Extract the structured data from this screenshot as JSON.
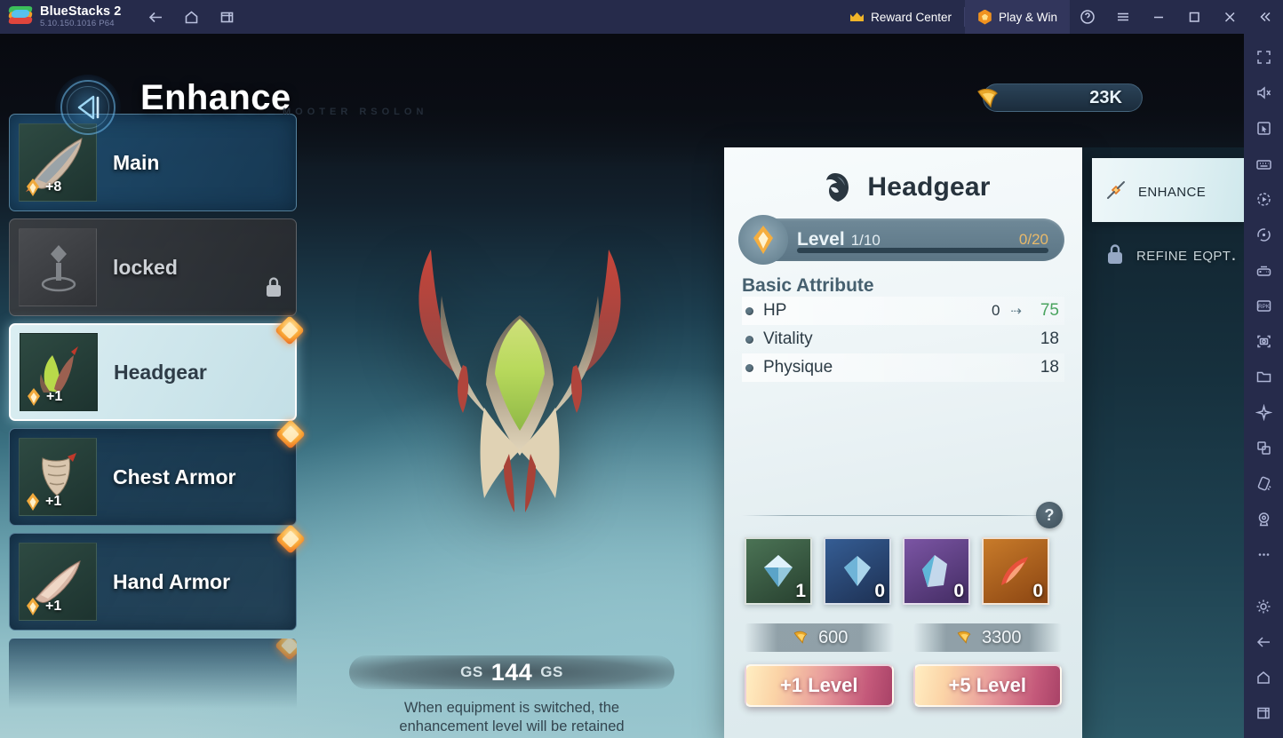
{
  "titlebar": {
    "app_name": "BlueStacks 2",
    "version": "5.10.150.1016  P64",
    "nav": [
      {
        "name": "back-icon",
        "label": "Back"
      },
      {
        "name": "home-icon",
        "label": "Home"
      },
      {
        "name": "recents-icon",
        "label": "Recent apps"
      }
    ],
    "reward_center": "Reward Center",
    "play_and_win": "Play & Win",
    "help_label": "Help",
    "menu_label": "Menu",
    "minimize_label": "Minimize",
    "maximize_label": "Maximize",
    "close_label": "Close",
    "collapse_label": "Collapse"
  },
  "game": {
    "title": "Enhance",
    "subtitle": "MOOTER RSOLON",
    "back_label": "Back",
    "currency": {
      "value": "23K",
      "icon": "fang-currency-icon"
    },
    "equipment": [
      {
        "name": "Main",
        "level": "+8",
        "state": "normal",
        "badge": false
      },
      {
        "name": "locked",
        "level": "",
        "state": "locked",
        "badge": false
      },
      {
        "name": "Headgear",
        "level": "+1",
        "state": "selected",
        "badge": true
      },
      {
        "name": "Chest Armor",
        "level": "+1",
        "state": "normal",
        "badge": true
      },
      {
        "name": "Hand Armor",
        "level": "+1",
        "state": "normal",
        "badge": true
      }
    ],
    "gs": {
      "label_left": "GS",
      "value": "144",
      "label_right": "GS",
      "hint_line1": "When equipment is switched, the",
      "hint_line2": "enhancement level will be retained"
    },
    "panel": {
      "item_name": "Headgear",
      "item_icon": "helmet-icon",
      "level_label": "Level",
      "level_value": "1/10",
      "exp_value": "0/20",
      "exp_percent": 0,
      "attributes_header": "Basic Attribute",
      "attributes": [
        {
          "name": "HP",
          "from": "0",
          "to": "75",
          "has_upgrade": true
        },
        {
          "name": "Vitality",
          "value": "18",
          "has_upgrade": false
        },
        {
          "name": "Physique",
          "value": "18",
          "has_upgrade": false
        }
      ],
      "help_label": "?",
      "materials": [
        {
          "name": "material-green",
          "count": "1",
          "color": "#3d6b4f"
        },
        {
          "name": "material-blue",
          "count": "0",
          "color": "#2c4d7d"
        },
        {
          "name": "material-purple",
          "count": "0",
          "color": "#6a4a8f"
        },
        {
          "name": "material-orange",
          "count": "0",
          "color": "#a85f27"
        }
      ],
      "costs": [
        "600",
        "3300"
      ],
      "actions": [
        "+1 Level",
        "+5 Level"
      ]
    },
    "tabs": [
      {
        "label": "Enhance",
        "state": "active",
        "icon": "hammer-enhance-icon"
      },
      {
        "label": "Refine Eqpt.",
        "state": "locked",
        "icon": "lock-icon"
      }
    ]
  },
  "sidebar": {
    "items": [
      {
        "name": "fullscreen-icon",
        "label": "Fullscreen"
      },
      {
        "name": "mute-icon",
        "label": "Mute"
      },
      {
        "name": "cursor-icon",
        "label": "Pointer"
      },
      {
        "name": "keyboard-controls-icon",
        "label": "Game controls"
      },
      {
        "name": "macro-icon",
        "label": "Macros"
      },
      {
        "name": "rotate-icon",
        "label": "Rotate"
      },
      {
        "name": "gamepad-icon",
        "label": "Gamepad"
      },
      {
        "name": "rpk-install-icon",
        "label": "Install APK"
      },
      {
        "name": "screenshot-icon",
        "label": "Screenshot"
      },
      {
        "name": "media-folder-icon",
        "label": "Media manager"
      },
      {
        "name": "airplane-icon",
        "label": "Eco mode"
      },
      {
        "name": "multi-instance-icon",
        "label": "Multi-instance"
      },
      {
        "name": "shake-icon",
        "label": "Shake"
      },
      {
        "name": "location-icon",
        "label": "Location"
      },
      {
        "name": "more-icon",
        "label": "More"
      },
      {
        "name": "settings-gear-icon",
        "label": "Settings"
      },
      {
        "name": "android-back-icon",
        "label": "Back"
      },
      {
        "name": "android-home-icon",
        "label": "Home"
      },
      {
        "name": "android-recents-icon",
        "label": "Recent apps"
      }
    ]
  }
}
